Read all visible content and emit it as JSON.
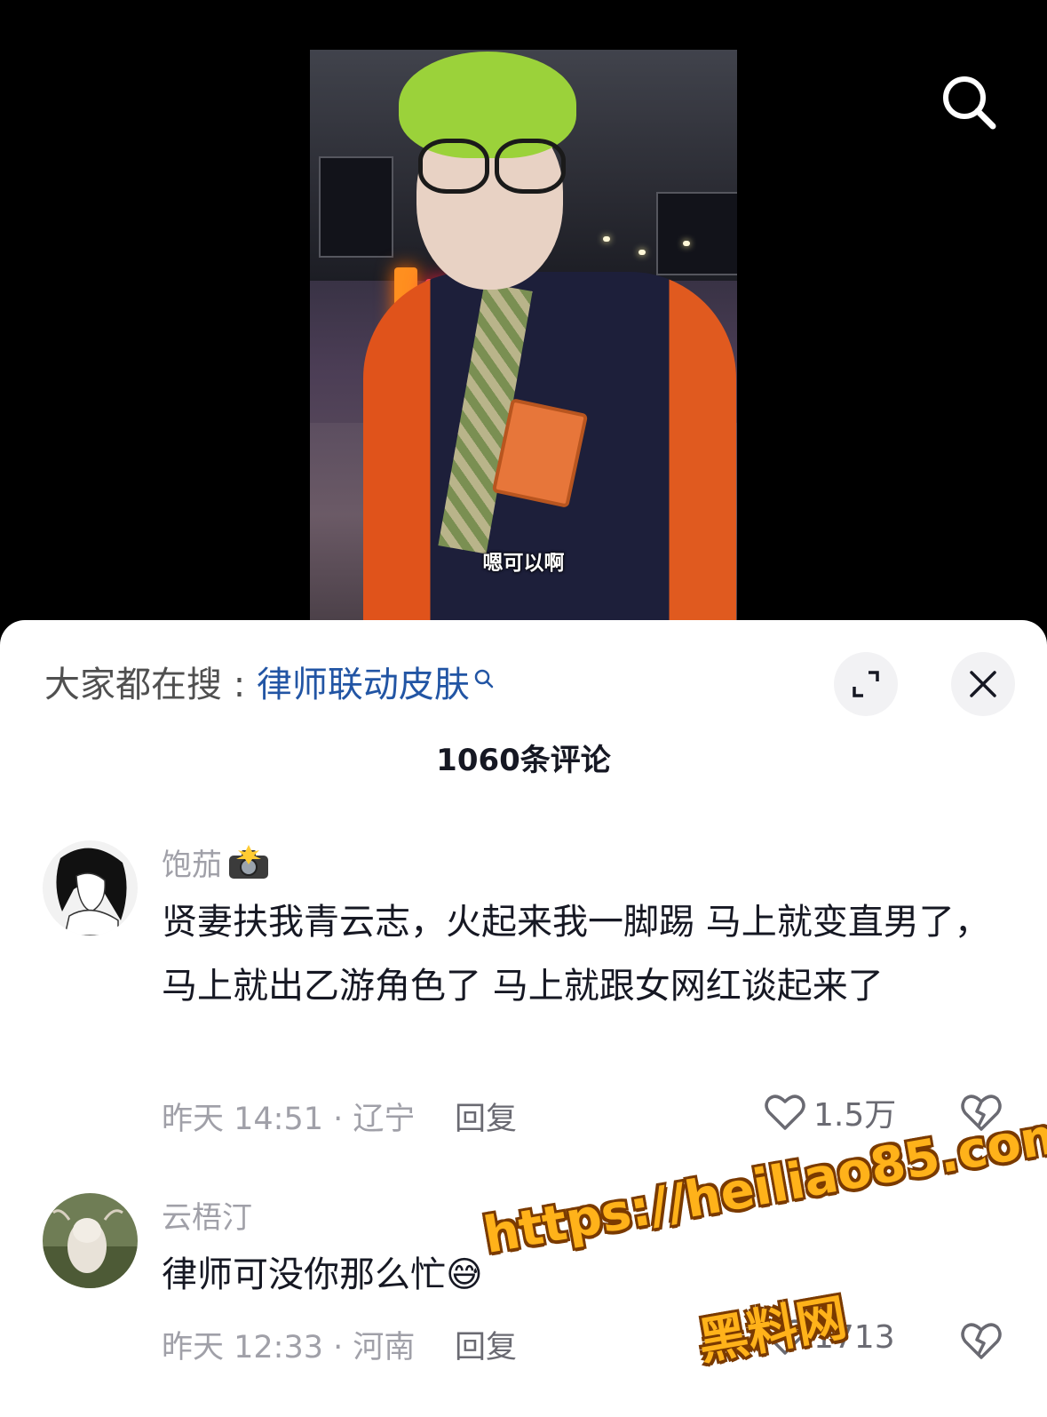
{
  "video": {
    "subtitle": "嗯可以啊"
  },
  "header": {
    "hot_search_prefix": "大家都在搜 : ",
    "hot_search_keyword": "律师联动皮肤",
    "comment_count_title": "1060条评论"
  },
  "comments": [
    {
      "username": "饱茄",
      "username_emoji": "camera-flash",
      "text": "贤妻扶我青云志，火起来我一脚踢 马上就变直男了，马上就出乙游角色了 马上就跟女网红谈起来了",
      "meta": "昨天 14:51 · 辽宁",
      "reply_label": "回复",
      "likes": "1.5万"
    },
    {
      "username": "云梧汀",
      "text": "律师可没你那么忙😅",
      "meta": "昨天 12:33 · 河南",
      "reply_label": "回复",
      "likes": "1713"
    }
  ],
  "watermark": {
    "url": "https://heiliao85.com",
    "name": "黑料网"
  },
  "colors": {
    "keyword": "#2255a4",
    "secondary_text": "#a0a0a8",
    "primary_text": "#161823",
    "watermark": "#ffb21a"
  },
  "icons": [
    "search-icon",
    "expand-icon",
    "close-icon",
    "heart-icon",
    "broken-heart-icon",
    "search-small-icon"
  ]
}
